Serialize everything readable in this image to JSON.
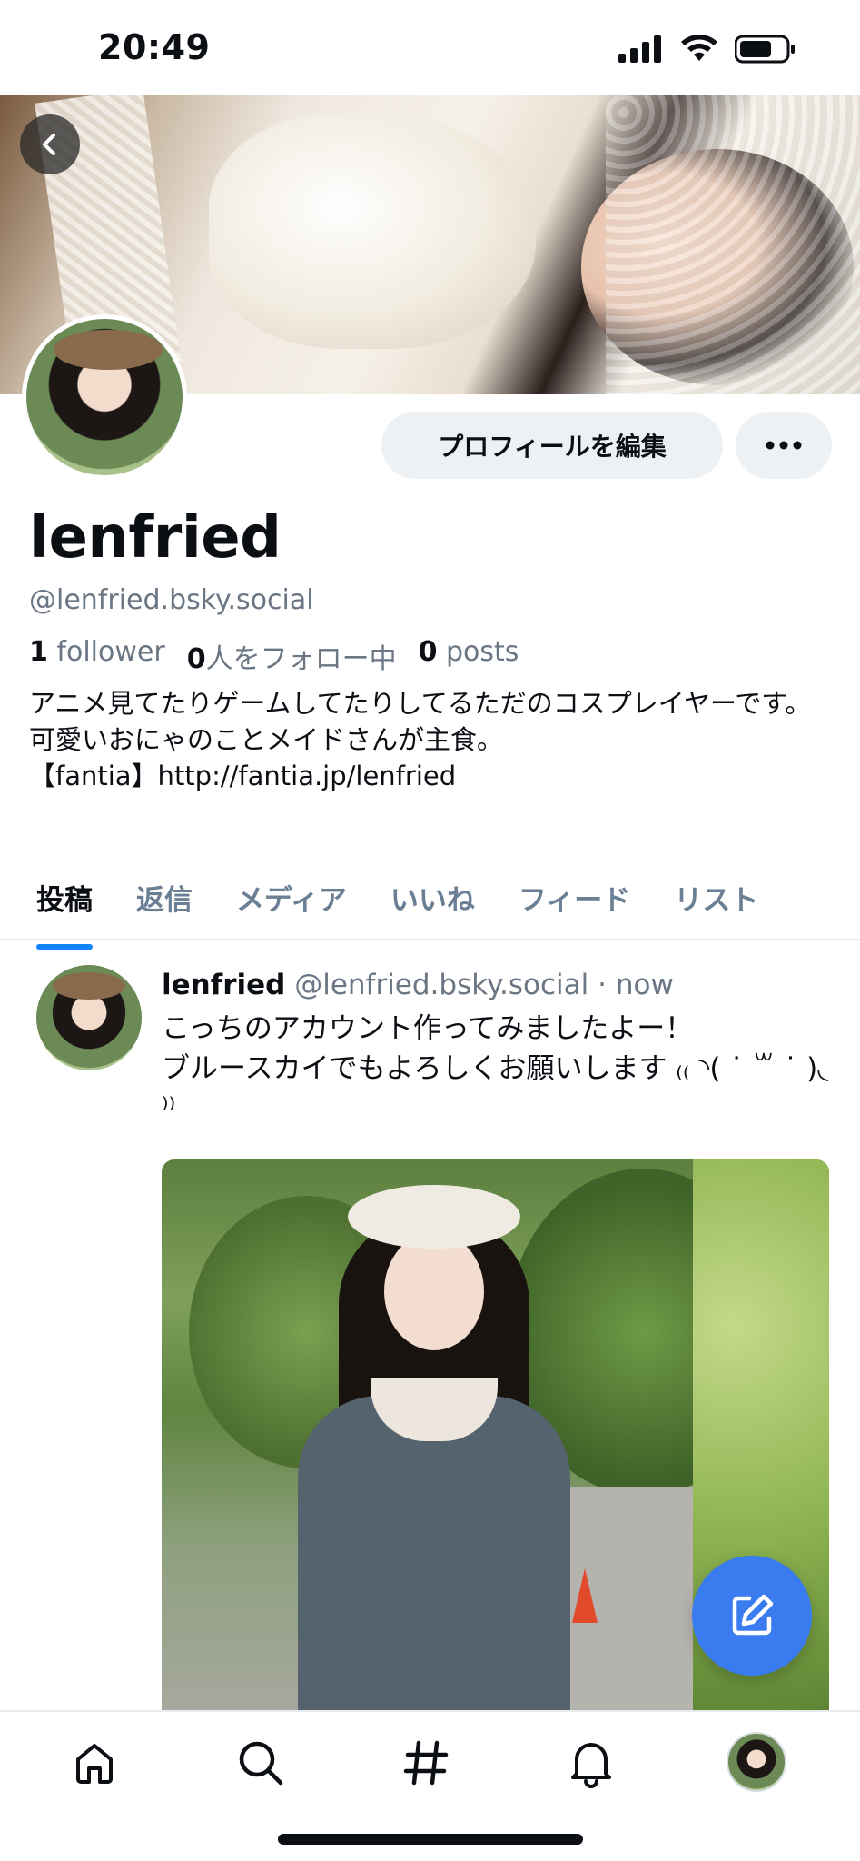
{
  "status_bar": {
    "time": "20:49"
  },
  "profile": {
    "display_name": "lenfried",
    "handle": "@lenfried.bsky.social",
    "followers_count": "1",
    "followers_label": "follower",
    "following_count": "0",
    "following_label": "人をフォロー中",
    "posts_count": "0",
    "posts_label": "posts",
    "bio": "アニメ見てたりゲームしてたりしてるただのコスプレイヤーです。\n可愛いおにゃのことメイドさんが主食。\n【fantia】http://fantia.jp/lenfried",
    "edit_button_label": "プロフィールを編集",
    "more_button_label": "•••"
  },
  "tabs": [
    {
      "label": "投稿",
      "active": true
    },
    {
      "label": "返信",
      "active": false
    },
    {
      "label": "メディア",
      "active": false
    },
    {
      "label": "いいね",
      "active": false
    },
    {
      "label": "フィード",
      "active": false
    },
    {
      "label": "リスト",
      "active": false
    }
  ],
  "post": {
    "author_name": "lenfried",
    "author_handle": "@lenfried.bsky.social",
    "separator": "·",
    "time": "now",
    "text": "こっちのアカウント作ってみましたよー！\nブルースカイでもよろしくお願いします ₍₍ ◝( ˙ ꒳ ˙ )◟ ⁾⁾"
  },
  "colors": {
    "accent": "#1083fe",
    "fab": "#3a7cf0",
    "muted_text": "#6b7684",
    "button_bg": "#eef1f4"
  },
  "icons": {
    "back": "chevron-left-icon",
    "more": "ellipsis-icon",
    "compose": "compose-icon",
    "home": "home-icon",
    "search": "search-icon",
    "feeds": "hash-icon",
    "notifications": "bell-icon"
  }
}
